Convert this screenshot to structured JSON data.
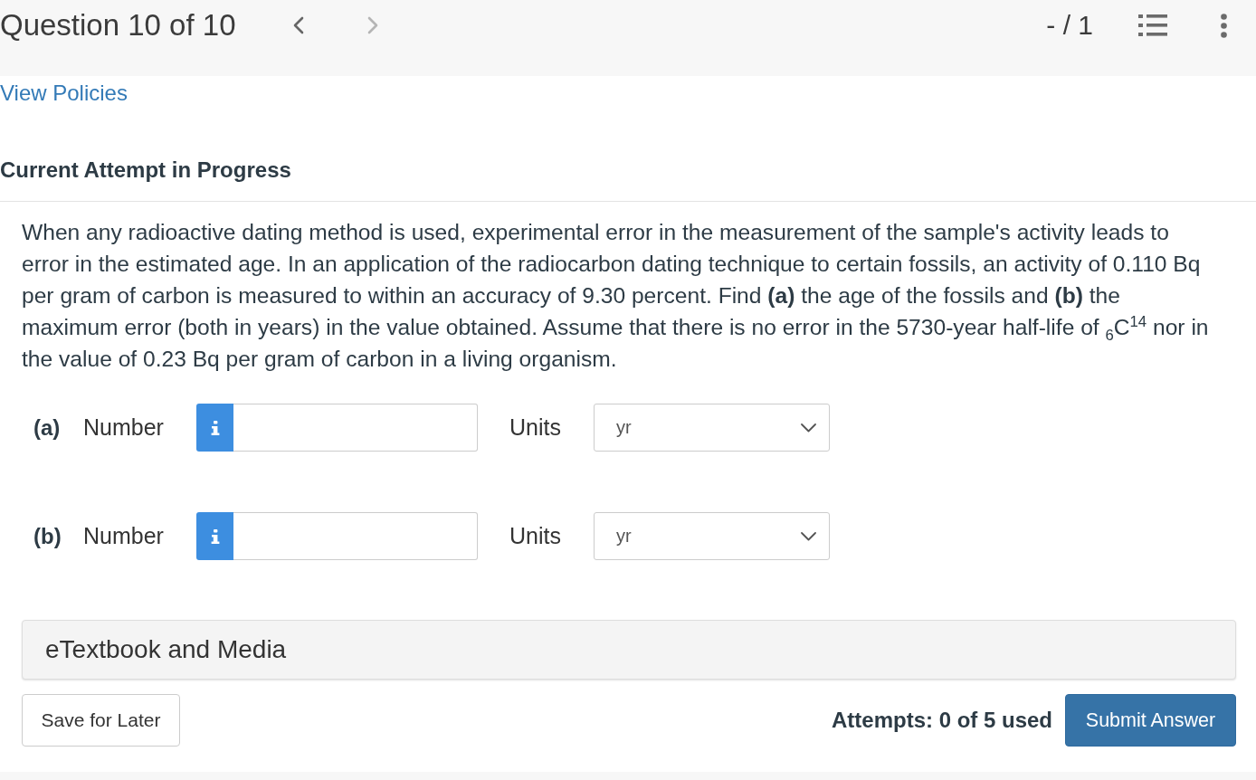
{
  "header": {
    "title": "Question 10 of 10",
    "nav": [
      {
        "kind": "previous",
        "disabled": false
      },
      {
        "kind": "next",
        "disabled": true
      }
    ],
    "score": "- / 1"
  },
  "policies_link": "View Policies",
  "attempt_heading": "Current Attempt in Progress",
  "question": {
    "text": "When any radioactive dating method is used, experimental error in the measurement of the sample's activity leads to error in the estimated age. In an application of the radiocarbon dating technique to certain fossils, an activity of 0.110 Bq per gram of carbon is measured to within an accuracy of 9.30 percent. Find **(a)** the age of the fossils and **(b)** the maximum error (both in years) in the value obtained. Assume that there is no error in the 5730-year half-life of $_{6}$C$^{14}$ nor in the value of 0.23 Bq per gram of carbon in a living organism.",
    "parts": [
      {
        "label": "(a)",
        "field_label": "Number",
        "units_label": "Units",
        "unit": "yr"
      },
      {
        "label": "(b)",
        "field_label": "Number",
        "units_label": "Units",
        "unit": "yr"
      }
    ]
  },
  "media_panel": {
    "title": "eTextbook and Media"
  },
  "footer": {
    "save_button": "Save for Later",
    "attempts": "Attempts: 0 of 5 used",
    "submit_button": "Submit Answer"
  }
}
